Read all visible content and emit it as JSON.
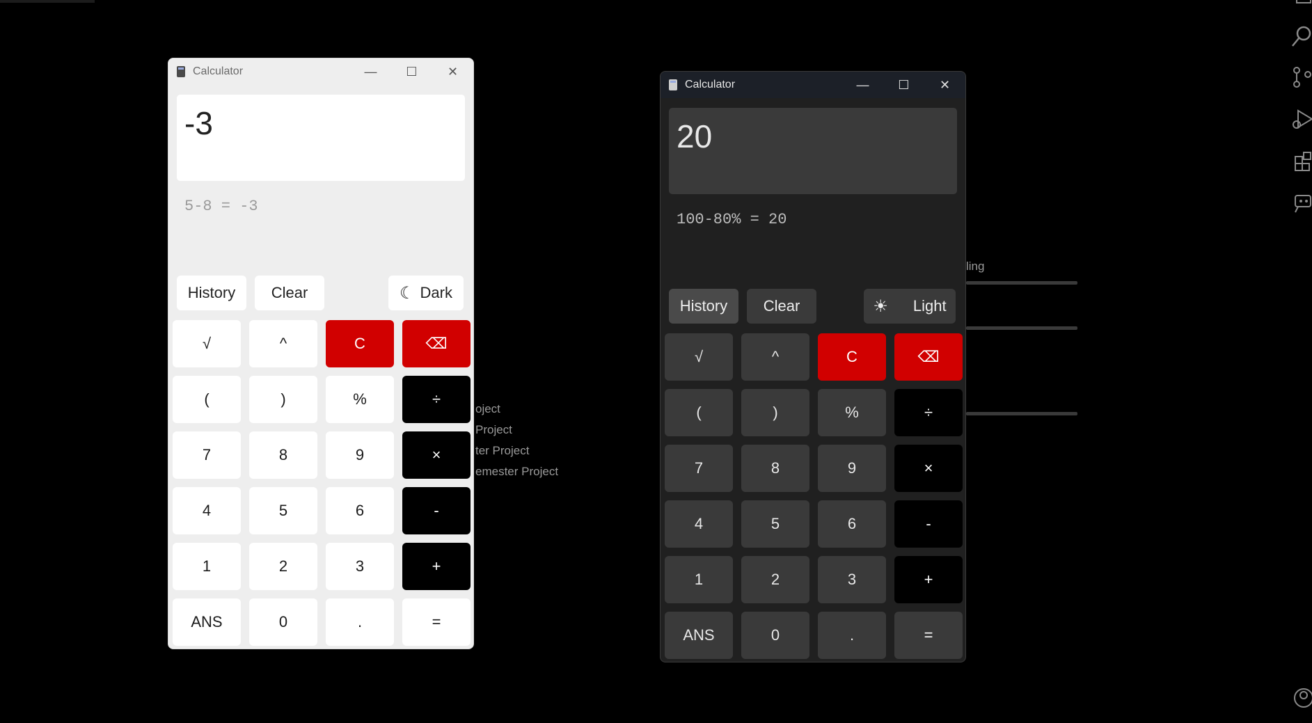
{
  "background": {
    "list_items": [
      "oject",
      "Project",
      "ter Project",
      "emester Project"
    ],
    "partial_label": "ling",
    "activity_icons": [
      "files-icon",
      "search-icon",
      "source-control-icon",
      "run-debug-icon",
      "extensions-icon",
      "remote-icon",
      "account-icon"
    ]
  },
  "calculators": [
    {
      "theme": "light",
      "title": "Calculator",
      "display": "-3",
      "expression": "5-8 = -3",
      "history_label": "History",
      "clear_label": "Clear",
      "theme_toggle": {
        "label": "Dark",
        "icon": "moon-icon",
        "glyph": "☾"
      },
      "controls": {
        "minimize": "—",
        "maximize": "☐",
        "close": "✕"
      }
    },
    {
      "theme": "dark",
      "title": "Calculator",
      "display": "20",
      "expression": "100-80% = 20",
      "history_label": "History",
      "clear_label": "Clear",
      "theme_toggle": {
        "label": "Light",
        "icon": "sun-icon",
        "glyph": "☀"
      },
      "controls": {
        "minimize": "—",
        "maximize": "☐",
        "close": "✕"
      }
    }
  ],
  "keys": [
    {
      "label": "√",
      "name": "sqrt-key",
      "kind": "num"
    },
    {
      "label": "^",
      "name": "power-key",
      "kind": "num"
    },
    {
      "label": "C",
      "name": "clear-entry-key",
      "kind": "danger"
    },
    {
      "label": "⌫",
      "name": "backspace-key",
      "kind": "danger"
    },
    {
      "label": "(",
      "name": "open-paren-key",
      "kind": "num"
    },
    {
      "label": ")",
      "name": "close-paren-key",
      "kind": "num"
    },
    {
      "label": "%",
      "name": "percent-key",
      "kind": "num"
    },
    {
      "label": "÷",
      "name": "divide-key",
      "kind": "op"
    },
    {
      "label": "7",
      "name": "digit-7-key",
      "kind": "num"
    },
    {
      "label": "8",
      "name": "digit-8-key",
      "kind": "num"
    },
    {
      "label": "9",
      "name": "digit-9-key",
      "kind": "num"
    },
    {
      "label": "×",
      "name": "multiply-key",
      "kind": "op"
    },
    {
      "label": "4",
      "name": "digit-4-key",
      "kind": "num"
    },
    {
      "label": "5",
      "name": "digit-5-key",
      "kind": "num"
    },
    {
      "label": "6",
      "name": "digit-6-key",
      "kind": "num"
    },
    {
      "label": "-",
      "name": "subtract-key",
      "kind": "op"
    },
    {
      "label": "1",
      "name": "digit-1-key",
      "kind": "num"
    },
    {
      "label": "2",
      "name": "digit-2-key",
      "kind": "num"
    },
    {
      "label": "3",
      "name": "digit-3-key",
      "kind": "num"
    },
    {
      "label": "+",
      "name": "add-key",
      "kind": "op"
    },
    {
      "label": "ANS",
      "name": "ans-key",
      "kind": "num"
    },
    {
      "label": "0",
      "name": "digit-0-key",
      "kind": "num"
    },
    {
      "label": ".",
      "name": "decimal-key",
      "kind": "num"
    },
    {
      "label": "=",
      "name": "equals-key",
      "kind": "eq"
    }
  ],
  "colors": {
    "danger": "#d10000",
    "operator": "#000000",
    "light_bg": "#eeeeee",
    "dark_bg": "#202020"
  }
}
